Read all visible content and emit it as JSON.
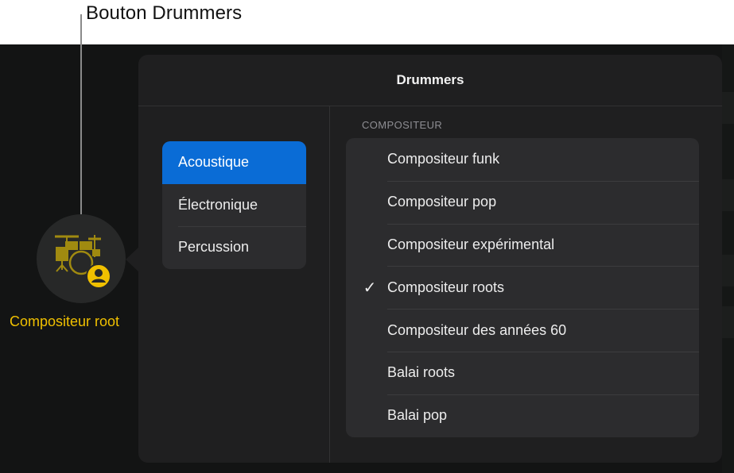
{
  "callout": {
    "label": "Bouton Drummers"
  },
  "drummer_button": {
    "icon": "drum-kit-icon",
    "badge_icon": "person-badge-icon",
    "label": "Compositeur root",
    "accent_color": "#f0c000"
  },
  "popover": {
    "title": "Drummers",
    "categories": [
      {
        "label": "Acoustique",
        "selected": true
      },
      {
        "label": "Électronique",
        "selected": false
      },
      {
        "label": "Percussion",
        "selected": false
      }
    ],
    "section_header": "COMPOSITEUR",
    "drummers": [
      {
        "label": "Compositeur funk",
        "checked": false
      },
      {
        "label": "Compositeur pop",
        "checked": false
      },
      {
        "label": "Compositeur expérimental",
        "checked": false
      },
      {
        "label": "Compositeur roots",
        "checked": true
      },
      {
        "label": "Compositeur des années 60",
        "checked": false
      },
      {
        "label": "Balai roots",
        "checked": false
      },
      {
        "label": "Balai pop",
        "checked": false
      }
    ],
    "check_glyph": "✓",
    "selection_color": "#0a6cd6"
  }
}
